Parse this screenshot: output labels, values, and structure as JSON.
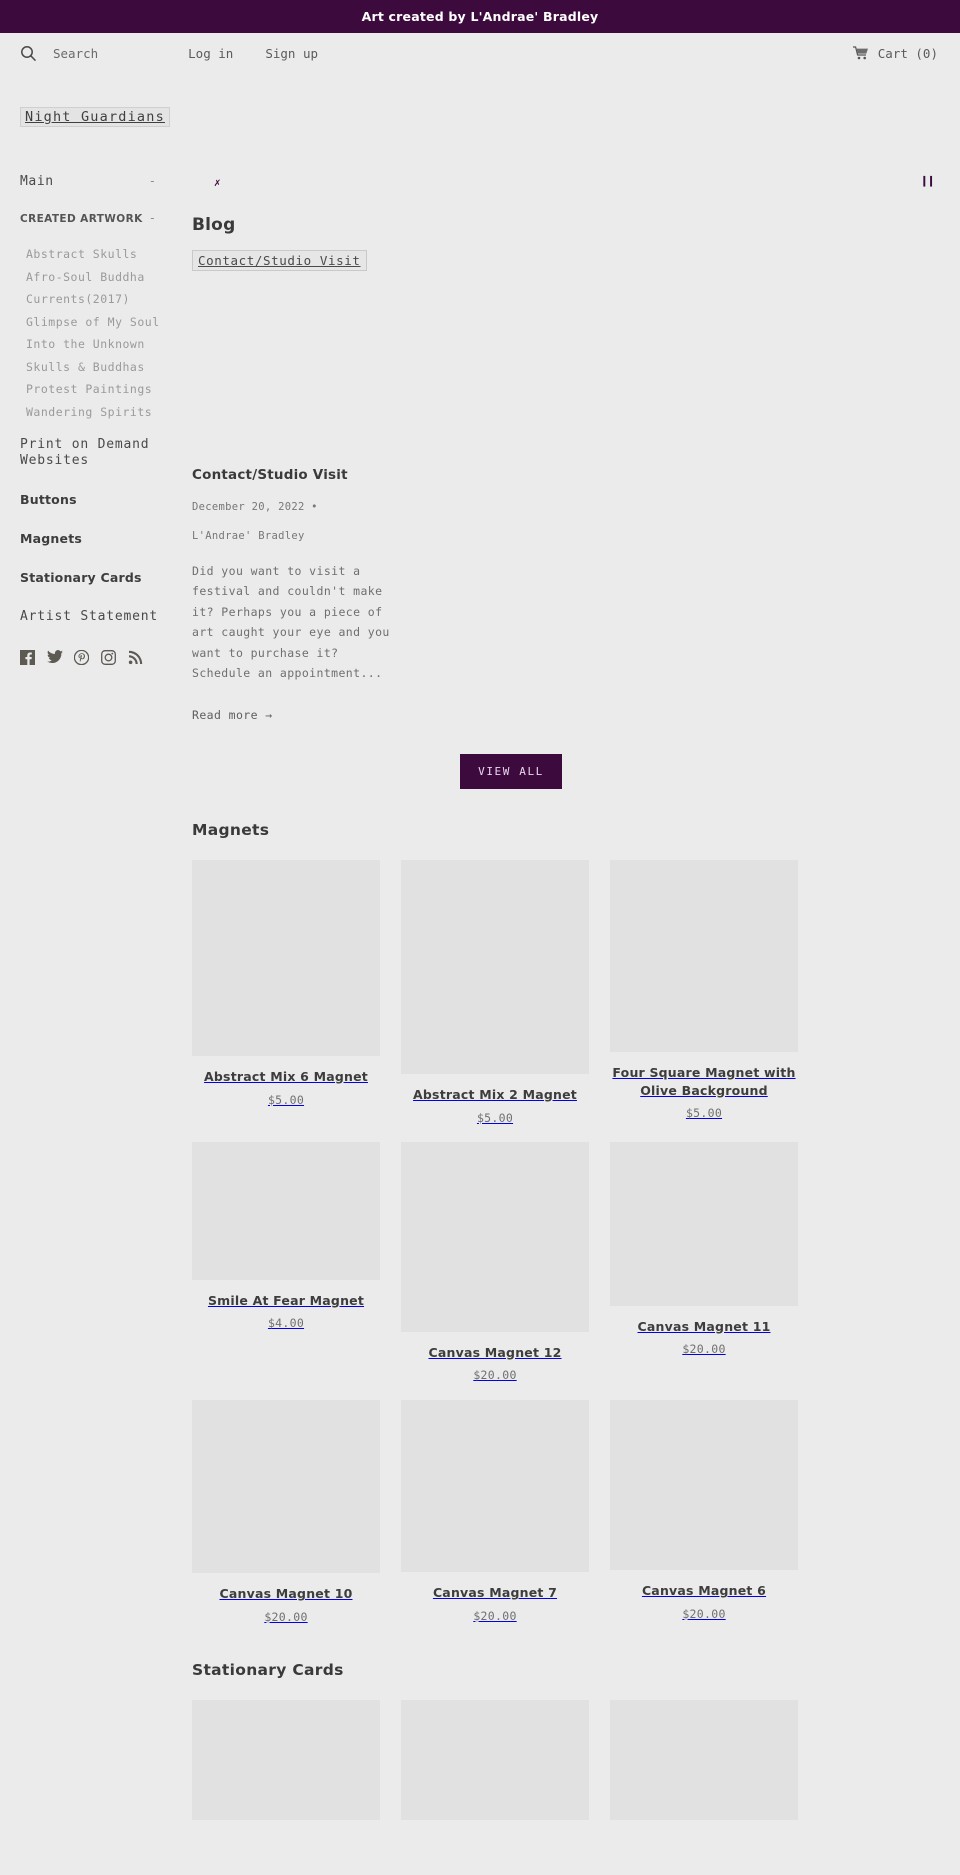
{
  "announcement": {
    "text": "Art created by L'Andrae' Bradley"
  },
  "header": {
    "search_label": "Search",
    "search_icon": "search-icon",
    "login_label": "Log in",
    "signup_label": "Sign up",
    "cart_label": "Cart (0)",
    "cart_icon": "shopping-cart-icon",
    "logo": "Night Guardians"
  },
  "sidebar": {
    "main_label": "Main",
    "main_toggle": "-",
    "created_artwork_label": "CREATED ARTWORK",
    "created_artwork_toggle": "-",
    "artwork_items": [
      {
        "label": "Abstract Skulls"
      },
      {
        "label": "Afro-Soul Buddha"
      },
      {
        "label": "Currents(2017)"
      },
      {
        "label": "Glimpse of My Soul"
      },
      {
        "label": "Into the Unknown"
      },
      {
        "label": "Skulls & Buddhas"
      },
      {
        "label": "Protest Paintings"
      },
      {
        "label": "Wandering Spirits"
      }
    ],
    "print_on_demand_label": "Print on Demand Websites",
    "buttons_label": "Buttons",
    "magnets_label": "Magnets",
    "stationary_cards_label": "Stationary Cards",
    "artist_statement_label": "Artist Statement",
    "social": [
      {
        "name": "facebook-icon"
      },
      {
        "name": "twitter-icon"
      },
      {
        "name": "pinterest-icon"
      },
      {
        "name": "instagram-icon"
      },
      {
        "name": "rss-icon"
      }
    ]
  },
  "slider": {
    "close_glyph": "✗",
    "pause_glyph": "❙❙"
  },
  "blog": {
    "heading": "Blog",
    "tag": "Contact/Studio Visit",
    "post": {
      "title": "Contact/Studio Visit",
      "date": "December 20, 2022  •",
      "author": "L'Andrae' Bradley",
      "excerpt": "Did you want to visit a festival and couldn't make it? Perhaps you a piece of art caught your eye and you want to purchase it?   Schedule an appointment...",
      "read_more": "Read more →"
    },
    "view_all_label": "VIEW ALL"
  },
  "sections": [
    {
      "title": "Magnets",
      "products": [
        {
          "name": "Abstract Mix 6 Magnet",
          "price": "$5.00",
          "media_height": 196
        },
        {
          "name": "Abstract Mix 2 Magnet",
          "price": "$5.00",
          "media_height": 214
        },
        {
          "name": "Four Square Magnet with Olive Background",
          "price": "$5.00",
          "media_height": 192
        },
        {
          "name": "Smile At Fear Magnet",
          "price": "$4.00",
          "media_height": 138
        },
        {
          "name": "Canvas Magnet 12",
          "price": "$20.00",
          "media_height": 190
        },
        {
          "name": "Canvas Magnet 11",
          "price": "$20.00",
          "media_height": 164
        },
        {
          "name": "Canvas Magnet 10",
          "price": "$20.00",
          "media_height": 173
        },
        {
          "name": "Canvas Magnet 7",
          "price": "$20.00",
          "media_height": 172
        },
        {
          "name": "Canvas Magnet 6",
          "price": "$20.00",
          "media_height": 170
        }
      ]
    },
    {
      "title": "Stationary Cards",
      "products": [
        {
          "name": "",
          "price": "",
          "media_height": 120
        },
        {
          "name": "",
          "price": "",
          "media_height": 120
        },
        {
          "name": "",
          "price": "",
          "media_height": 120
        }
      ]
    }
  ],
  "colors": {
    "accent": "#3d0a3d",
    "page_bg": "#ebebeb",
    "placeholder": "#e1e1e1"
  }
}
